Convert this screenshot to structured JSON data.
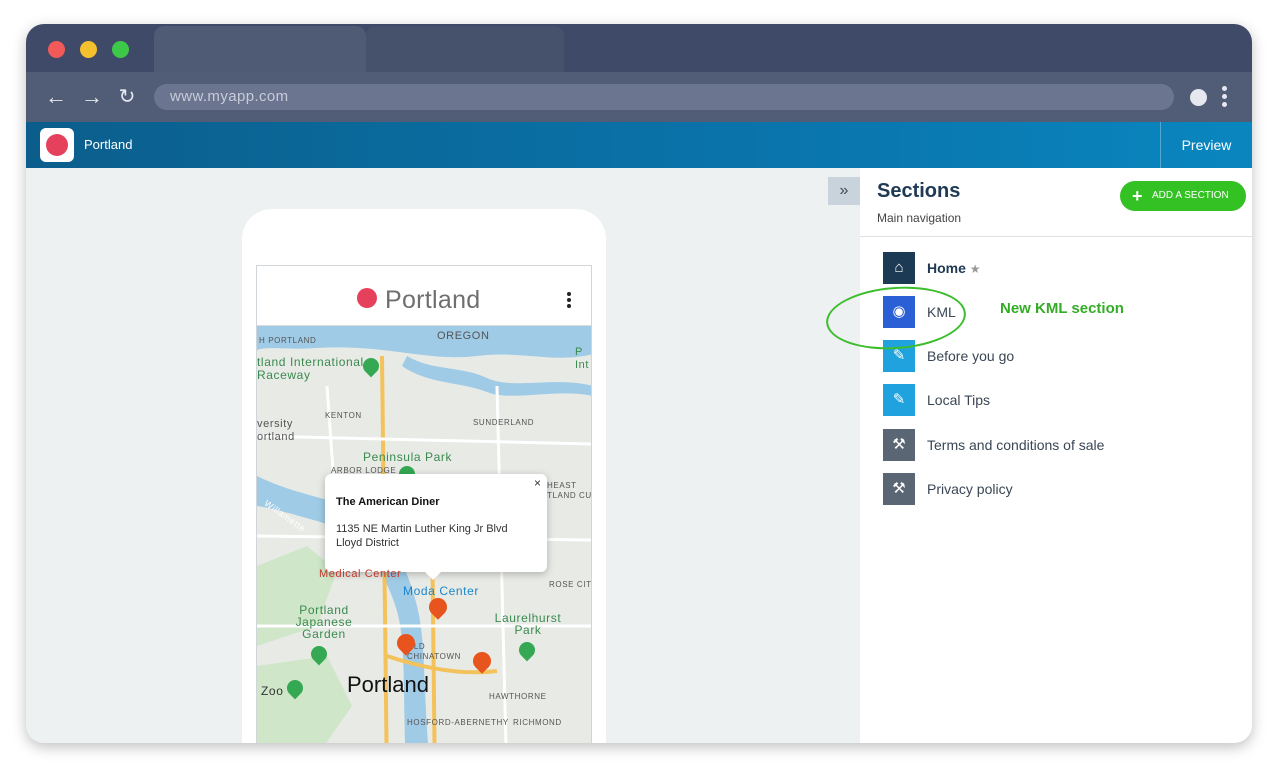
{
  "browser": {
    "url": "www.myapp.com",
    "traffic_colors": {
      "close": "#f25a5a",
      "minimize": "#f5c02e",
      "maximize": "#3ec84a"
    }
  },
  "app": {
    "name": "Portland",
    "preview_label": "Preview",
    "brand_color": "#0a78b0"
  },
  "phone": {
    "title": "Portland",
    "map": {
      "labels": {
        "oregon": "OREGON",
        "north_portland": "H PORTLAND",
        "raceway": "tland International Raceway",
        "kenton": "KENTON",
        "sunderland": "SUNDERLAND",
        "university": "versity ortland",
        "peninsula_park": "Peninsula Park",
        "arbor_lodge": "ARBOR LODGE",
        "northeast": "HEAST TLAND CU",
        "medical_center": "Medical Center",
        "moda_center": "Moda Center",
        "rose_city": "ROSE CIT",
        "japanese_garden": "Portland Japanese Garden",
        "laurelhurst": "Laurelhurst Park",
        "old_town": "OLD CHINATOWN",
        "zoo": "Zoo",
        "city": "Portland",
        "hawthorne": "HAWTHORNE",
        "hosford": "HOSFORD-ABERNETHY",
        "richmond": "RICHMOND",
        "intl": "P Int",
        "willamette": "Willamette"
      },
      "popup": {
        "title": "The American Diner",
        "address_line1": "1135 NE Martin Luther King Jr Blvd",
        "address_line2": "Lloyd District",
        "close": "×"
      }
    }
  },
  "sections": {
    "title": "Sections",
    "subtitle": "Main navigation",
    "add_button": "ADD A SECTION",
    "items": [
      {
        "label": "Home",
        "icon": "home-icon",
        "color": "#1d3a55",
        "starred": true
      },
      {
        "label": "KML",
        "icon": "globe-icon",
        "color": "#2a5fd6"
      },
      {
        "label": "Before you go",
        "icon": "pencil-icon",
        "color": "#1fa2dd"
      },
      {
        "label": "Local Tips",
        "icon": "pencil-icon",
        "color": "#1fa2dd"
      },
      {
        "label": "Terms and conditions of sale",
        "icon": "gavel-icon",
        "color": "#5b6675"
      },
      {
        "label": "Privacy policy",
        "icon": "gavel-icon",
        "color": "#5b6675"
      }
    ],
    "annotation": "New KML section"
  }
}
